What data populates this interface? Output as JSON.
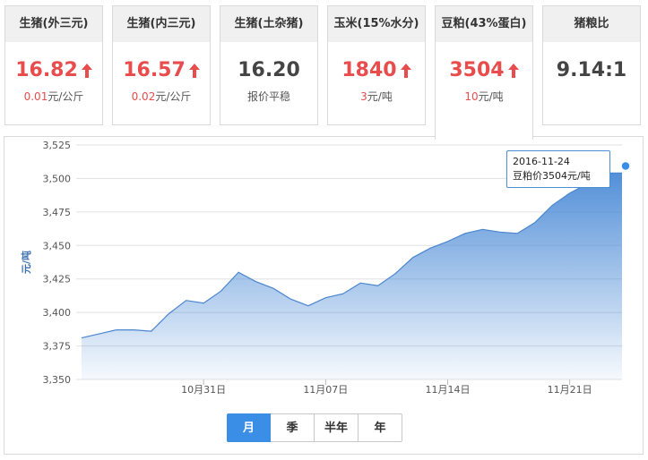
{
  "cards": [
    {
      "title": "生猪(外三元)",
      "value": "16.82",
      "trend": "up",
      "change_num": "0.01",
      "change_unit": "元/公斤"
    },
    {
      "title": "生猪(内三元)",
      "value": "16.57",
      "trend": "up",
      "change_num": "0.02",
      "change_unit": "元/公斤"
    },
    {
      "title": "生猪(土杂猪)",
      "value": "16.20",
      "trend": "flat",
      "change_num": "",
      "change_unit": "报价平稳"
    },
    {
      "title": "玉米(15%水分)",
      "value": "1840",
      "trend": "up",
      "change_num": "3",
      "change_unit": "元/吨"
    },
    {
      "title": "豆粕(43%蛋白)",
      "value": "3504",
      "trend": "up",
      "change_num": "10",
      "change_unit": "元/吨"
    },
    {
      "title": "猪粮比",
      "value": "9.14:1",
      "trend": "flat",
      "change_num": "",
      "change_unit": ""
    }
  ],
  "active_card": 4,
  "colors": {
    "up": "#e84c4c",
    "line": "#4a86cf",
    "area_top": "#4a8ad6",
    "grid": "#e0e0e0",
    "accent": "#3a8ee6"
  },
  "range_buttons": [
    "月",
    "季",
    "半年",
    "年"
  ],
  "active_range": 0,
  "tooltip": {
    "date": "2016-11-24",
    "text": "豆粕价3504元/吨"
  },
  "chart_data": {
    "type": "area",
    "ylabel": "元/吨",
    "ylim": [
      3350,
      3525
    ],
    "yticks": [
      3350,
      3375,
      3400,
      3425,
      3450,
      3475,
      3500,
      3525
    ],
    "ytick_labels": [
      "3,350",
      "3,375",
      "3,400",
      "3,425",
      "3,450",
      "3,475",
      "3,500",
      "3,525"
    ],
    "xlim": [
      "2016-10-24",
      "2016-11-24"
    ],
    "xticks": [
      "2016-10-31",
      "2016-11-07",
      "2016-11-14",
      "2016-11-21"
    ],
    "xtick_labels": [
      "10月31日",
      "11月07日",
      "11月14日",
      "11月21日"
    ],
    "grid": true,
    "series": [
      {
        "x": [
          "2016-10-24",
          "2016-10-25",
          "2016-10-26",
          "2016-10-27",
          "2016-10-28",
          "2016-10-29",
          "2016-10-30",
          "2016-10-31",
          "2016-11-01",
          "2016-11-02",
          "2016-11-03",
          "2016-11-04",
          "2016-11-05",
          "2016-11-06",
          "2016-11-07",
          "2016-11-08",
          "2016-11-09",
          "2016-11-10",
          "2016-11-11",
          "2016-11-12",
          "2016-11-13",
          "2016-11-14",
          "2016-11-15",
          "2016-11-16",
          "2016-11-17",
          "2016-11-18",
          "2016-11-19",
          "2016-11-20",
          "2016-11-21",
          "2016-11-22",
          "2016-11-23",
          "2016-11-24"
        ],
        "values": [
          3381,
          3384,
          3387,
          3387,
          3386,
          3399,
          3409,
          3407,
          3416,
          3430,
          3423,
          3418,
          3410,
          3405,
          3411,
          3414,
          3422,
          3420,
          3429,
          3441,
          3448,
          3453,
          3459,
          3462,
          3460,
          3459,
          3467,
          3480,
          3489,
          3496,
          3504,
          3504
        ]
      }
    ]
  }
}
